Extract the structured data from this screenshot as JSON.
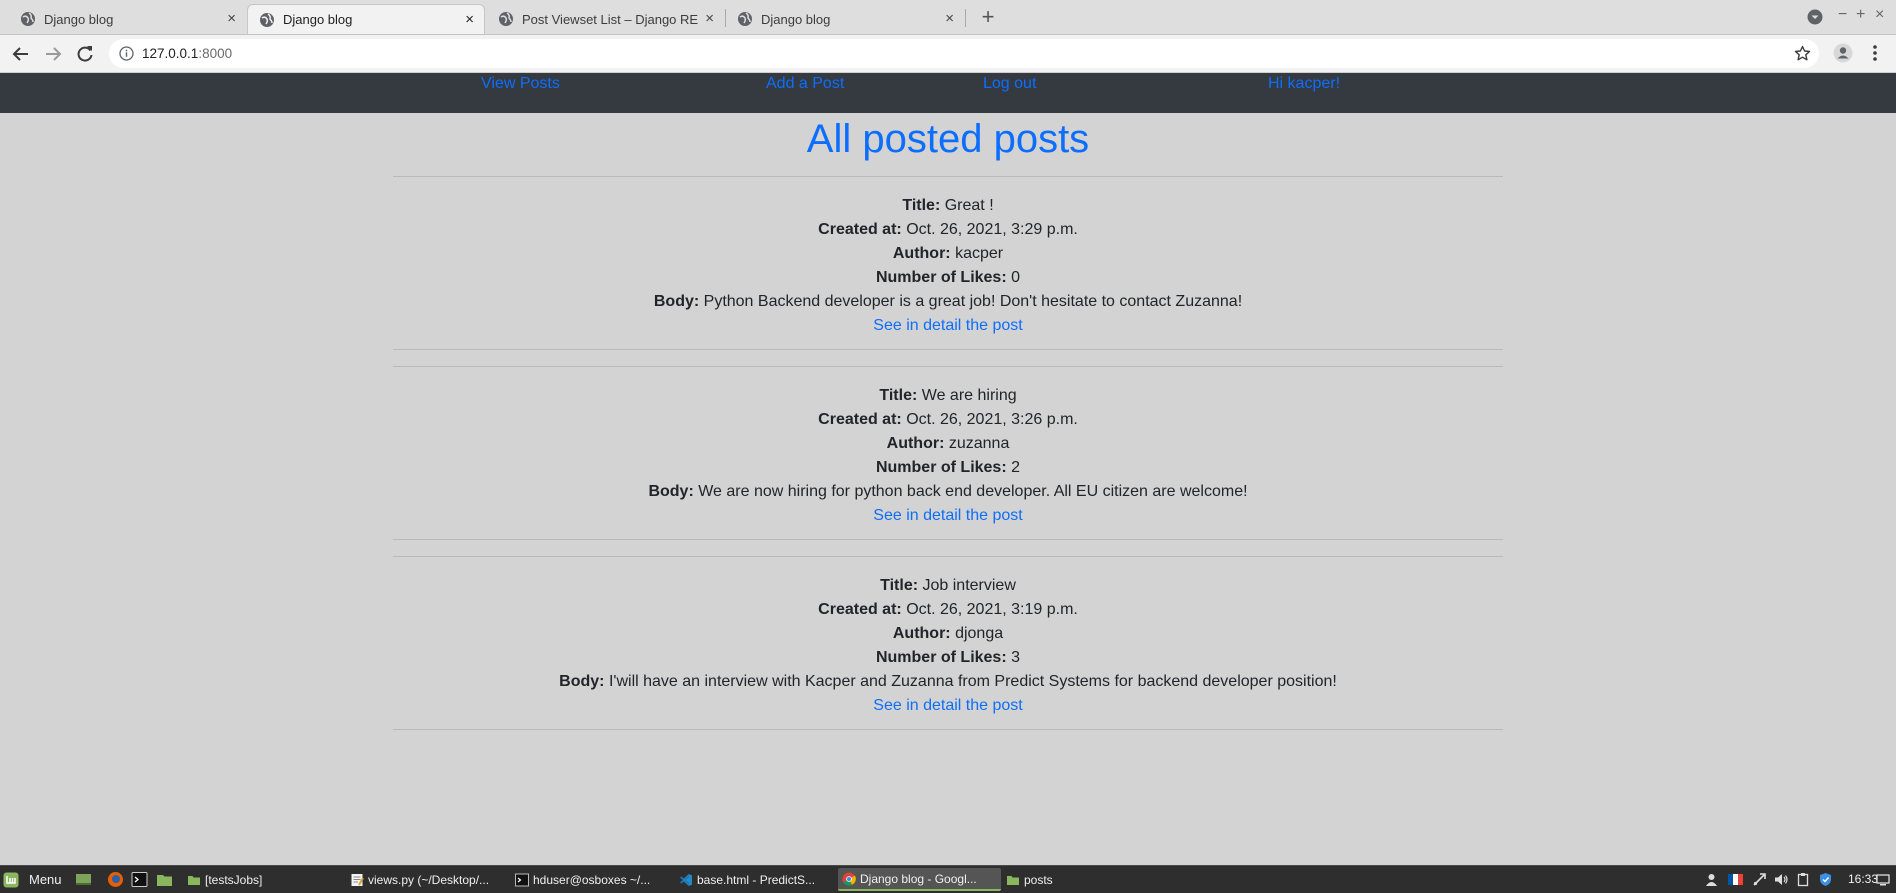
{
  "browser": {
    "tabs": [
      {
        "title": "Django blog",
        "active": false
      },
      {
        "title": "Django blog",
        "active": true
      },
      {
        "title": "Post Viewset List – Django REST",
        "active": false
      },
      {
        "title": "Django blog",
        "active": false
      }
    ],
    "new_tab_label": "+",
    "close_glyph": "×",
    "window_controls": {
      "minimize": "−",
      "maximize": "+",
      "close": "×"
    },
    "url": {
      "host": "127.0.0.1",
      "port": ":8000"
    }
  },
  "site_nav": {
    "links": [
      {
        "label": "View Posts"
      },
      {
        "label": "Add a Post"
      },
      {
        "label": "Log out"
      },
      {
        "label": "Hi kacper!"
      }
    ]
  },
  "main": {
    "title": "All posted posts",
    "labels": {
      "title": "Title:",
      "created_at": "Created at:",
      "author": "Author:",
      "likes": "Number of Likes:",
      "body": "Body:"
    },
    "detail_link_label": "See in detail the post",
    "posts": [
      {
        "title": "Great !",
        "created_at": "Oct. 26, 2021, 3:29 p.m.",
        "author": "kacper",
        "likes": "0",
        "body": "Python Backend developer is a great job! Don't hesitate to contact Zuzanna!"
      },
      {
        "title": "We are hiring",
        "created_at": "Oct. 26, 2021, 3:26 p.m.",
        "author": "zuzanna",
        "likes": "2",
        "body": "We are now hiring for python back end developer. All EU citizen are welcome!"
      },
      {
        "title": "Job interview",
        "created_at": "Oct. 26, 2021, 3:19 p.m.",
        "author": "djonga",
        "likes": "3",
        "body": "I'will have an interview with Kacper and Zuzanna from Predict Systems for backend developer position!"
      }
    ]
  },
  "taskbar": {
    "menu_label": "Menu",
    "tasks": [
      {
        "label": "[testsJobs]",
        "icon": "folder-icon",
        "active": false
      },
      {
        "label": "views.py (~/Desktop/...",
        "icon": "text-editor-icon",
        "active": false
      },
      {
        "label": "hduser@osboxes ~/...",
        "icon": "terminal-icon",
        "active": false
      },
      {
        "label": "base.html - PredictS...",
        "icon": "vscode-icon",
        "active": false
      },
      {
        "label": "Django blog - Googl...",
        "icon": "chrome-icon",
        "active": true
      },
      {
        "label": "posts",
        "icon": "folder-icon",
        "active": false
      }
    ],
    "clock": "16:33",
    "colors": {
      "active_indicator": "#8ab75e",
      "mint_green": "#8ab75e"
    }
  },
  "colors": {
    "link": "#0d6efd",
    "navbar_bg": "#343a40",
    "page_bg": "#d3d3d3"
  }
}
